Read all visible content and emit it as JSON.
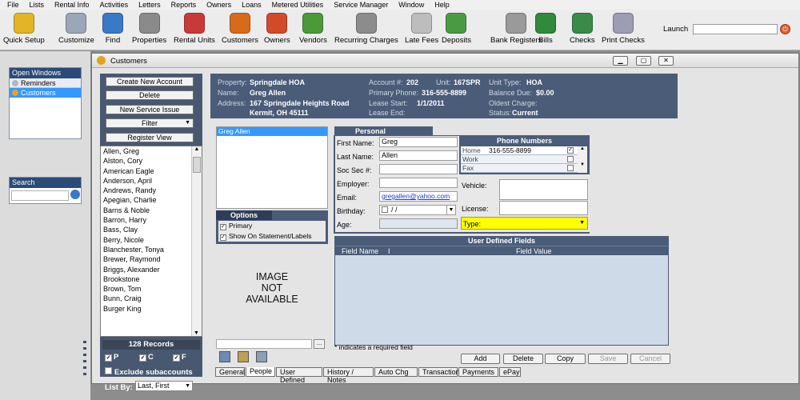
{
  "menu": [
    "File",
    "Lists",
    "Rental Info",
    "Activities",
    "Letters",
    "Reports",
    "Owners",
    "Loans",
    "Metered Utilities",
    "Service Manager",
    "Window",
    "Help"
  ],
  "toolbar": [
    {
      "label": "Quick Setup",
      "icon": "quick-setup-icon",
      "color": "#e2b526"
    },
    {
      "label": "Customize",
      "icon": "customize-icon",
      "color": "#9aa7b8"
    },
    {
      "label": "Find",
      "icon": "find-icon",
      "color": "#3a78c8"
    },
    {
      "label": "Properties",
      "icon": "properties-icon",
      "color": "#8a8a8a"
    },
    {
      "label": "Rental Units",
      "icon": "rental-units-icon",
      "color": "#c83a3a"
    },
    {
      "label": "Customers",
      "icon": "customers-icon",
      "color": "#d86a1c"
    },
    {
      "label": "Owners",
      "icon": "owners-icon",
      "color": "#d24a2a"
    },
    {
      "label": "Vendors",
      "icon": "vendors-icon",
      "color": "#4a9a3a"
    },
    {
      "label": "Recurring Charges",
      "icon": "recurring-charges-icon",
      "color": "#8c8c8c"
    },
    {
      "label": "Late Fees",
      "icon": "late-fees-icon",
      "color": "#bdbdbd"
    },
    {
      "label": "Deposits",
      "icon": "deposits-icon",
      "color": "#4a9a44"
    },
    {
      "label": "Bank Registers",
      "icon": "bank-registers-icon",
      "color": "#9a9a9a"
    },
    {
      "label": "Bills",
      "icon": "bills-icon",
      "color": "#2f8a3a"
    },
    {
      "label": "Checks",
      "icon": "checks-icon",
      "color": "#3a8a4a"
    },
    {
      "label": "Print Checks",
      "icon": "print-checks-icon",
      "color": "#9c9cb4"
    }
  ],
  "launch": {
    "label": "Launch",
    "value": ""
  },
  "left": {
    "open_windows_title": "Open Windows",
    "items": [
      "Reminders",
      "Customers"
    ],
    "search_title": "Search",
    "search_value": ""
  },
  "window": {
    "title": "Customers"
  },
  "actions": [
    "Create New Account",
    "Delete",
    "New Service Issue",
    "Filter",
    "Register View"
  ],
  "customers": [
    "Allen, Greg",
    "Alston, Cory",
    "American Eagle",
    "Anderson, April",
    "Andrews, Randy",
    "Apegian, Charlie",
    "Barns & Noble",
    "Barron, Harry",
    "Bass, Clay",
    "Berry, Nicole",
    "Blanchester, Tonya",
    "Brewer, Raymond",
    "Briggs, Alexander",
    "Brookstone",
    "Brown, Tom",
    "Bunn, Craig",
    "Burger King"
  ],
  "records": {
    "count_label": "128 Records",
    "p": "P",
    "c": "C",
    "f": "F",
    "exclude": "Exclude subaccounts",
    "listby_label": "List By:",
    "listby_value": "Last, First"
  },
  "info": {
    "property_label": "Property:",
    "property": "Springdale HOA",
    "name_label": "Name:",
    "name": "Greg Allen",
    "address_label": "Address:",
    "address1": "167 Springdale Heights Road",
    "address2": "Kermit, OH 45111",
    "account_label": "Account #:",
    "account": "202",
    "unit_label": "Unit:",
    "unit": "167SPR",
    "phone_label": "Primary Phone:",
    "phone": "316-555-8899",
    "lease_start_label": "Lease Start:",
    "lease_start": "1/1/2011",
    "lease_end_label": "Lease End:",
    "lease_end": "",
    "unit_type_label": "Unit Type:",
    "unit_type": "HOA",
    "balance_label": "Balance Due:",
    "balance": "$0.00",
    "oldest_label": "Oldest Charge:",
    "oldest": "",
    "status_label": "Status:",
    "status": "Current"
  },
  "people_list": [
    "Greg Allen"
  ],
  "options": {
    "title": "Options",
    "primary": "Primary",
    "show": "Show On Statement/Labels"
  },
  "image_na": [
    "IMAGE",
    "NOT",
    "AVAILABLE"
  ],
  "personal": {
    "tab": "Personal",
    "first_label": "First Name:",
    "first": "Greg",
    "last_label": "Last Name:",
    "last": "Allen",
    "ssn_label": "Soc Sec #:",
    "ssn": "",
    "employer_label": "Employer:",
    "employer": "",
    "email_label": "Email:",
    "email": "gregallen@yahoo.com",
    "birthday_label": "Birthday:",
    "birthday": "/   /",
    "age_label": "Age:",
    "age": "",
    "vehicle_label": "Vehicle:",
    "license_label": "License:",
    "type_label": "Type:"
  },
  "phones": {
    "title": "Phone Numbers",
    "rows": [
      {
        "type": "Home",
        "number": "316-555-8899",
        "checked": true
      },
      {
        "type": "Work",
        "number": "",
        "checked": false
      },
      {
        "type": "Fax",
        "number": "",
        "checked": false
      }
    ]
  },
  "udf": {
    "title": "User Defined Fields",
    "col1": "Field Name",
    "col2": "I",
    "col3": "Field Value"
  },
  "required_note": "* indicates a required field",
  "buttons": [
    "Add",
    "Delete",
    "Copy",
    "Save",
    "Cancel"
  ],
  "tabs": [
    "General",
    "People",
    "User Defined",
    "History / Notes",
    "Auto Chg",
    "Transaction",
    "Payments",
    "ePay"
  ],
  "colors": {
    "dark_panel": "#4a5c78",
    "highlight": "#ffff00",
    "selection": "#3399ff"
  }
}
